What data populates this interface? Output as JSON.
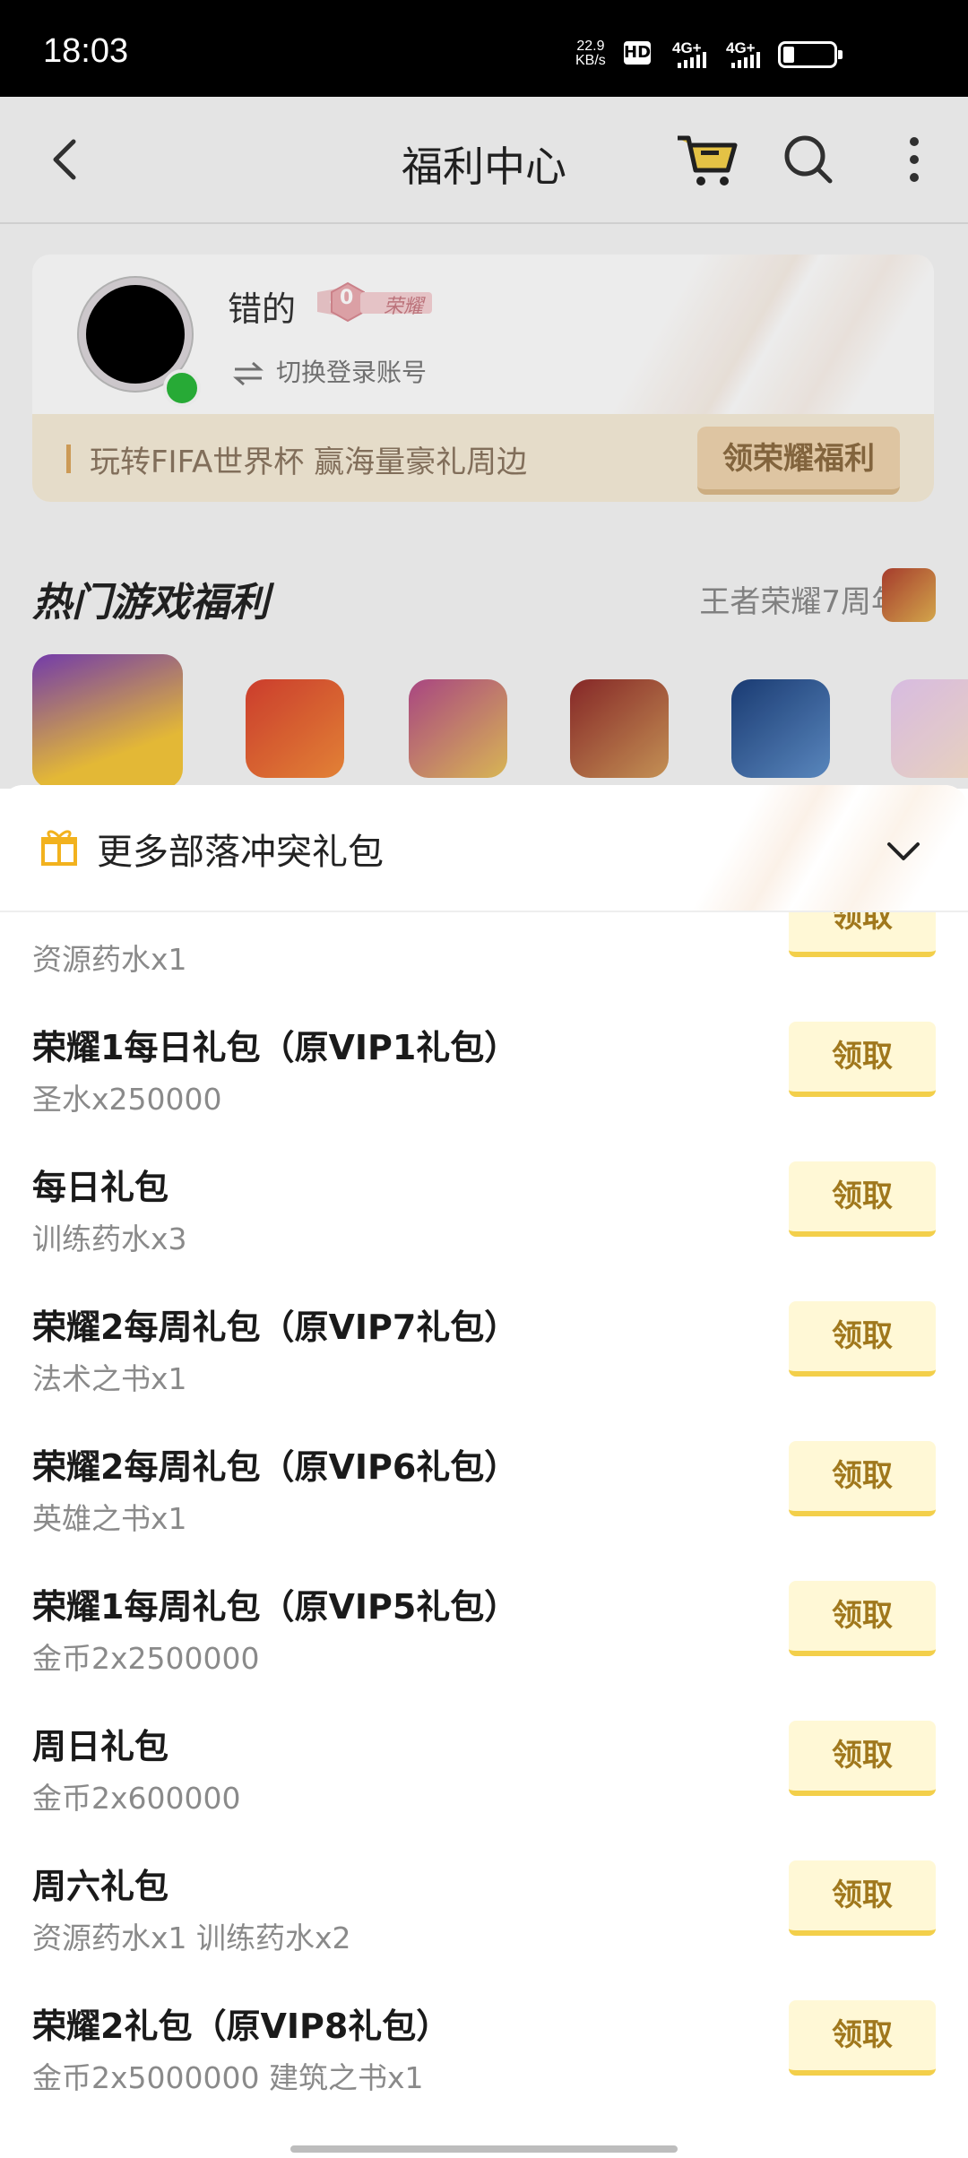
{
  "status_bar": {
    "time": "18:03",
    "net_speed_value": "22.9",
    "net_speed_unit": "KB/s",
    "hd_label": "HD",
    "sim1": "4G+",
    "sim2": "4G+"
  },
  "header": {
    "title": "福利中心",
    "back_icon": "back-arrow-icon",
    "cart_icon": "cart-icon",
    "search_icon": "search-icon",
    "more_icon": "more-vertical-icon"
  },
  "account": {
    "username": "错的",
    "level_number": "0",
    "level_label": "荣耀",
    "switch_label": "切换登录账号"
  },
  "promo": {
    "text": "玩转FIFA世界杯 赢海量豪礼周边",
    "button": "领荣耀福利"
  },
  "hot_games": {
    "title": "热门游戏福利",
    "right_label": "王者荣耀7周年"
  },
  "sheet": {
    "title": "更多部落冲突礼包",
    "claim_label": "领取",
    "items": [
      {
        "name": "",
        "desc": "资源药水x1"
      },
      {
        "name": "荣耀1每日礼包（原VIP1礼包）",
        "desc": "圣水x250000"
      },
      {
        "name": "每日礼包",
        "desc": "训练药水x3"
      },
      {
        "name": "荣耀2每周礼包（原VIP7礼包）",
        "desc": "法术之书x1"
      },
      {
        "name": "荣耀2每周礼包（原VIP6礼包）",
        "desc": "英雄之书x1"
      },
      {
        "name": "荣耀1每周礼包（原VIP5礼包）",
        "desc": "金币2x2500000"
      },
      {
        "name": "周日礼包",
        "desc": "金币2x600000"
      },
      {
        "name": "周六礼包",
        "desc": "资源药水x1 训练药水x2"
      },
      {
        "name": "荣耀2礼包（原VIP8礼包）",
        "desc": "金币2x5000000 建筑之书x1"
      }
    ]
  },
  "colors": {
    "accent_gold": "#f3cf4a",
    "claim_text": "#a0781d",
    "promo_bg": "#f4ead6"
  }
}
